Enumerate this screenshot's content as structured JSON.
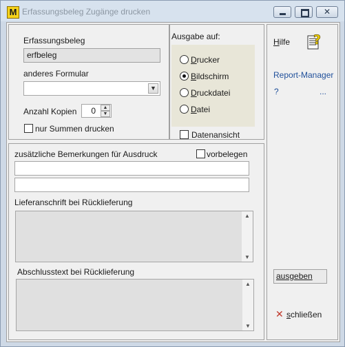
{
  "window": {
    "title": "Erfassungsbeleg Zugänge drucken",
    "app_icon_letter": "M"
  },
  "left": {
    "erfassungsbeleg_label": "Erfassungsbeleg",
    "erfassungsbeleg_value": "erfbeleg",
    "anderes_formular_label": "anderes Formular",
    "anderes_formular_value": "",
    "anzahl_kopien_label": "Anzahl Kopien",
    "anzahl_kopien_value": "0",
    "nur_summen_label": "nur Summen drucken"
  },
  "ausgabe": {
    "title": "Ausgabe auf:",
    "options": [
      {
        "hot": "D",
        "rest": "rucker",
        "selected": false
      },
      {
        "hot": "B",
        "rest": "ildschirm",
        "selected": true
      },
      {
        "hot": "D",
        "rest": "ruckdatei",
        "selected": false
      },
      {
        "hot": "D",
        "rest": "atei",
        "selected": false
      }
    ],
    "datenansicht_label": "Datenansicht"
  },
  "lower": {
    "bemerkungen_label": "zusätzliche Bemerkungen für Ausdruck",
    "vorbelegen_label": "vorbelegen",
    "bemerkung1": "",
    "bemerkung2": "",
    "lieferanschrift_label": "Lieferanschrift bei  Rücklieferung",
    "abschlusstext_label": "Abschlusstext bei Rücklieferung"
  },
  "sidebar": {
    "hilfe_hot": "H",
    "hilfe_rest": "ilfe",
    "report_manager": "Report-Manager",
    "question": "?",
    "ellipsis": "...",
    "ausgeben_label": "ausgeben",
    "schliessen_hot": "s",
    "schliessen_rest": "chließen"
  }
}
